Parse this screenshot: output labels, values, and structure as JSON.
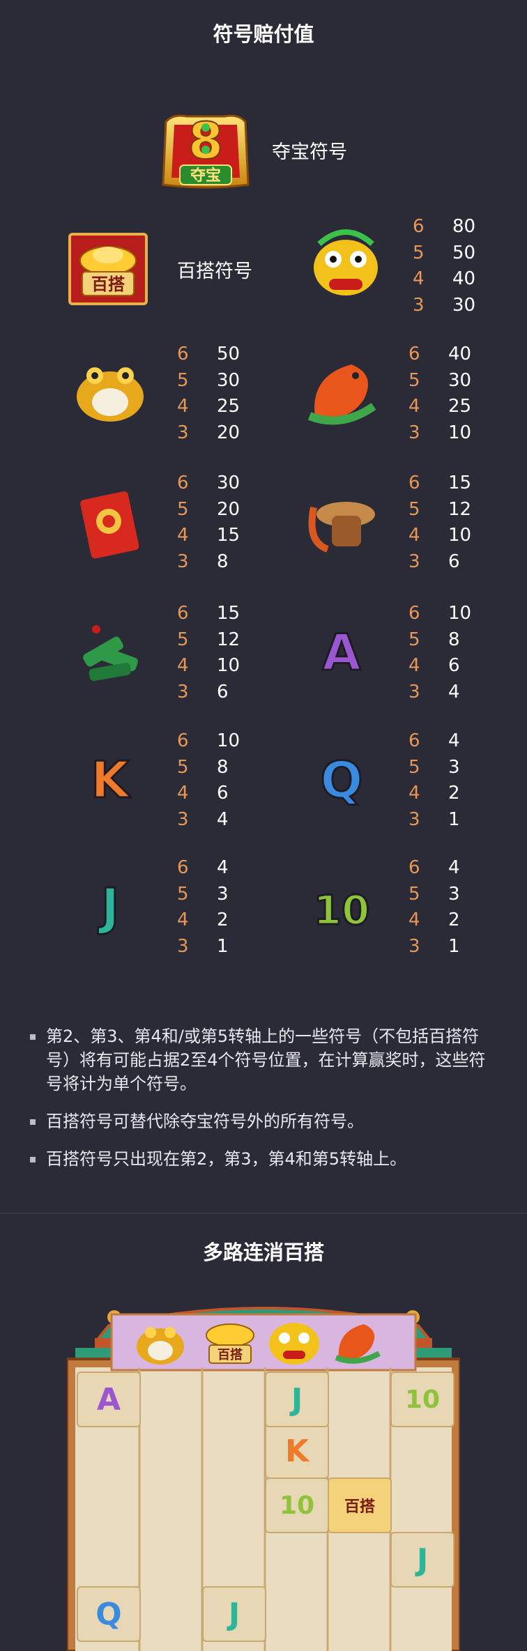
{
  "section1": {
    "title": "符号赔付值"
  },
  "scatter": {
    "label": "夺宝符号",
    "icon": "scatter-8-icon",
    "icon_text": "夺宝"
  },
  "wild": {
    "label": "百搭符号",
    "icon": "gold-ingot-wild-icon",
    "icon_text": "百搭"
  },
  "symbols": [
    {
      "icon": "lion-dance-icon",
      "pays": [
        {
          "c": "6",
          "v": "80"
        },
        {
          "c": "5",
          "v": "50"
        },
        {
          "c": "4",
          "v": "40"
        },
        {
          "c": "3",
          "v": "30"
        }
      ]
    },
    {
      "icon": "golden-toad-icon",
      "pays": [
        {
          "c": "6",
          "v": "50"
        },
        {
          "c": "5",
          "v": "30"
        },
        {
          "c": "4",
          "v": "25"
        },
        {
          "c": "3",
          "v": "20"
        }
      ]
    },
    {
      "icon": "koi-fish-icon",
      "pays": [
        {
          "c": "6",
          "v": "40"
        },
        {
          "c": "5",
          "v": "30"
        },
        {
          "c": "4",
          "v": "25"
        },
        {
          "c": "3",
          "v": "10"
        }
      ]
    },
    {
      "icon": "red-envelope-icon",
      "pays": [
        {
          "c": "6",
          "v": "30"
        },
        {
          "c": "5",
          "v": "20"
        },
        {
          "c": "4",
          "v": "15"
        },
        {
          "c": "3",
          "v": "8"
        }
      ]
    },
    {
      "icon": "gong-icon",
      "pays": [
        {
          "c": "6",
          "v": "15"
        },
        {
          "c": "5",
          "v": "12"
        },
        {
          "c": "4",
          "v": "10"
        },
        {
          "c": "3",
          "v": "6"
        }
      ]
    },
    {
      "icon": "firecracker-icon",
      "pays": [
        {
          "c": "6",
          "v": "15"
        },
        {
          "c": "5",
          "v": "12"
        },
        {
          "c": "4",
          "v": "10"
        },
        {
          "c": "3",
          "v": "6"
        }
      ]
    },
    {
      "icon": "letter-a-icon",
      "text": "A",
      "pays": [
        {
          "c": "6",
          "v": "10"
        },
        {
          "c": "5",
          "v": "8"
        },
        {
          "c": "4",
          "v": "6"
        },
        {
          "c": "3",
          "v": "4"
        }
      ]
    },
    {
      "icon": "letter-k-icon",
      "text": "K",
      "pays": [
        {
          "c": "6",
          "v": "10"
        },
        {
          "c": "5",
          "v": "8"
        },
        {
          "c": "4",
          "v": "6"
        },
        {
          "c": "3",
          "v": "4"
        }
      ]
    },
    {
      "icon": "letter-q-icon",
      "text": "Q",
      "pays": [
        {
          "c": "6",
          "v": "4"
        },
        {
          "c": "5",
          "v": "3"
        },
        {
          "c": "4",
          "v": "2"
        },
        {
          "c": "3",
          "v": "1"
        }
      ]
    },
    {
      "icon": "letter-j-icon",
      "text": "J",
      "pays": [
        {
          "c": "6",
          "v": "4"
        },
        {
          "c": "5",
          "v": "3"
        },
        {
          "c": "4",
          "v": "2"
        },
        {
          "c": "3",
          "v": "1"
        }
      ]
    },
    {
      "icon": "number-10-icon",
      "text": "10",
      "pays": [
        {
          "c": "6",
          "v": "4"
        },
        {
          "c": "5",
          "v": "3"
        },
        {
          "c": "4",
          "v": "2"
        },
        {
          "c": "3",
          "v": "1"
        }
      ]
    }
  ],
  "rules": [
    "第2、第3、第4和/或第5转轴上的一些符号（不包括百搭符号）将有可能占据2至4个符号位置，在计算赢奖时，这些符号将计为单个符号。",
    "百搭符号可替代除夺宝符号外的所有符号。",
    "百搭符号只出现在第2，第3，第4和第5转轴上。"
  ],
  "section2": {
    "title": "多路连消百搭"
  },
  "board": {
    "top_row": [
      "golden-toad-icon",
      "gold-ingot-wild-icon",
      "lion-dance-icon",
      "koi-fish-icon"
    ],
    "cells": [
      "A",
      "K",
      "Q",
      "J",
      "10"
    ],
    "wild_text": "百搭"
  },
  "colors": {
    "background": "#2b2a37",
    "count": "#e59858",
    "value": "#ffffff"
  }
}
